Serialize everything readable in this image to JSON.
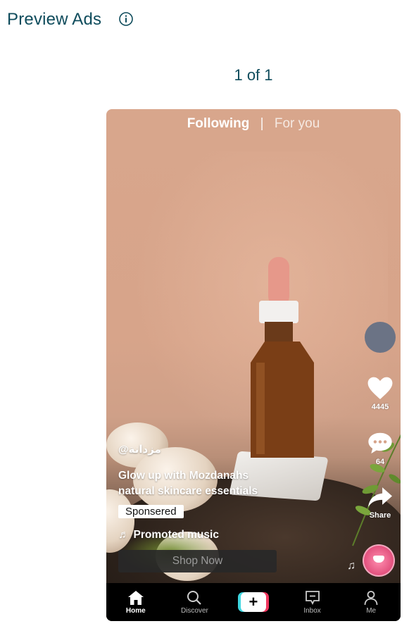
{
  "header": {
    "title": "Preview Ads",
    "info_icon": "info-circle-icon"
  },
  "pager": {
    "text": "1 of 1"
  },
  "preview": {
    "tabs": {
      "following": "Following",
      "separator": "|",
      "for_you": "For you"
    },
    "side_actions": {
      "likes": "4445",
      "comments": "64",
      "share_label": "Share"
    },
    "caption": {
      "handle": "@مزدانة",
      "description": "Glow up with Mozdanahs natural skincare essentials",
      "sponsored_label": "Sponsered",
      "music_label": "Promoted music",
      "cta_label": "Shop Now"
    },
    "bottom_nav": [
      {
        "label": "Home",
        "icon": "home-icon",
        "active": true
      },
      {
        "label": "Discover",
        "icon": "search-icon",
        "active": false
      },
      {
        "label": "",
        "icon": "create-plus-icon",
        "active": false
      },
      {
        "label": "Inbox",
        "icon": "inbox-icon",
        "active": false
      },
      {
        "label": "Me",
        "icon": "profile-icon",
        "active": false
      }
    ],
    "colors": {
      "brand_text": "#0f4c5c",
      "avatar": "#6b7385",
      "create_cyan": "#3fd6e0",
      "create_pink": "#f0365e"
    }
  }
}
